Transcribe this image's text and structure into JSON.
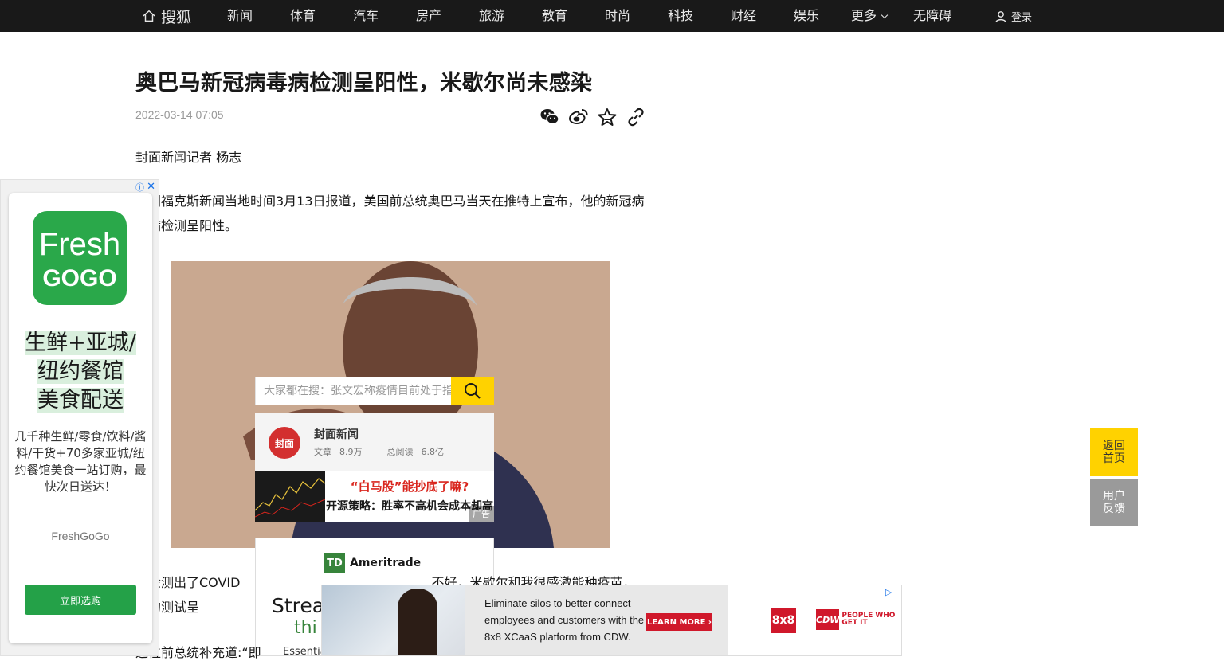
{
  "nav": {
    "logo_text": "搜狐",
    "items": [
      "新闻",
      "体育",
      "汽车",
      "房产",
      "旅游",
      "教育",
      "时尚",
      "科技",
      "财经",
      "娱乐"
    ],
    "more_label": "更多",
    "accessibility_label": "无障碍",
    "login_label": "登录"
  },
  "article": {
    "title": "奥巴马新冠病毒病检测呈阳性，米歇尔尚未感染",
    "date": "2022-03-14 07:05",
    "byline": "封面新闻记者 杨志",
    "para1": "美国福克斯新闻当地时间3月13日报道，美国前总统奥巴马当天在推特上宣布，他的新冠病毒病检测呈阳性。",
    "para2": "刚检测出了COVID　　　　　　　　　　　　　　　不好，米歇尔和我很感激能种疫苗，她的测试呈",
    "para3": "这位前总统补充道:“即"
  },
  "share_icons": [
    "wechat-icon",
    "weibo-icon",
    "star-icon",
    "link-icon"
  ],
  "search": {
    "placeholder": "大家都在搜：张文宏称疫情目前处于指"
  },
  "author_card": {
    "avatar_text": "封面",
    "name": "封面新闻",
    "articles_label": "文章",
    "articles_value": "8.9万",
    "reads_label": "总阅读",
    "reads_value": "6.8亿"
  },
  "promo_banner": {
    "headline": "“白马股”能抄底了嘛?",
    "subline": "开源策略：胜率不高机会成本却高",
    "ad_tag": "广告"
  },
  "td_ad": {
    "brand": "Ameritrade",
    "box": "TD",
    "line1": "Strea",
    "line2": "thi",
    "line3": "Essentia"
  },
  "left_ad": {
    "logo_line1": "Fresh",
    "logo_line2": "GOGO",
    "headline_lines": [
      "生鲜+亚城/",
      "纽约餐馆",
      "美食配送"
    ],
    "body": "几千种生鲜/零食/饮料/酱料/干货+70多家亚城/纽约餐馆美食一站订购，最快次日送达！",
    "brand": "FreshGoGo",
    "cta": "立即选购"
  },
  "bottom_ad": {
    "text": "Eliminate silos to better connect employees and customers with the 8x8 XCaaS platform from CDW.",
    "cta": "LEARN MORE ›",
    "logo1": "8x8",
    "logo2": "CDW",
    "slogan": "PEOPLE WHO GET IT"
  },
  "side": {
    "back_home": "返回首页",
    "feedback": "用户反馈"
  },
  "colors": {
    "nav_bg": "#191919",
    "accent_yellow": "#ffd200",
    "fresh_green": "#2aa84a",
    "cdw_red": "#d0182b"
  }
}
